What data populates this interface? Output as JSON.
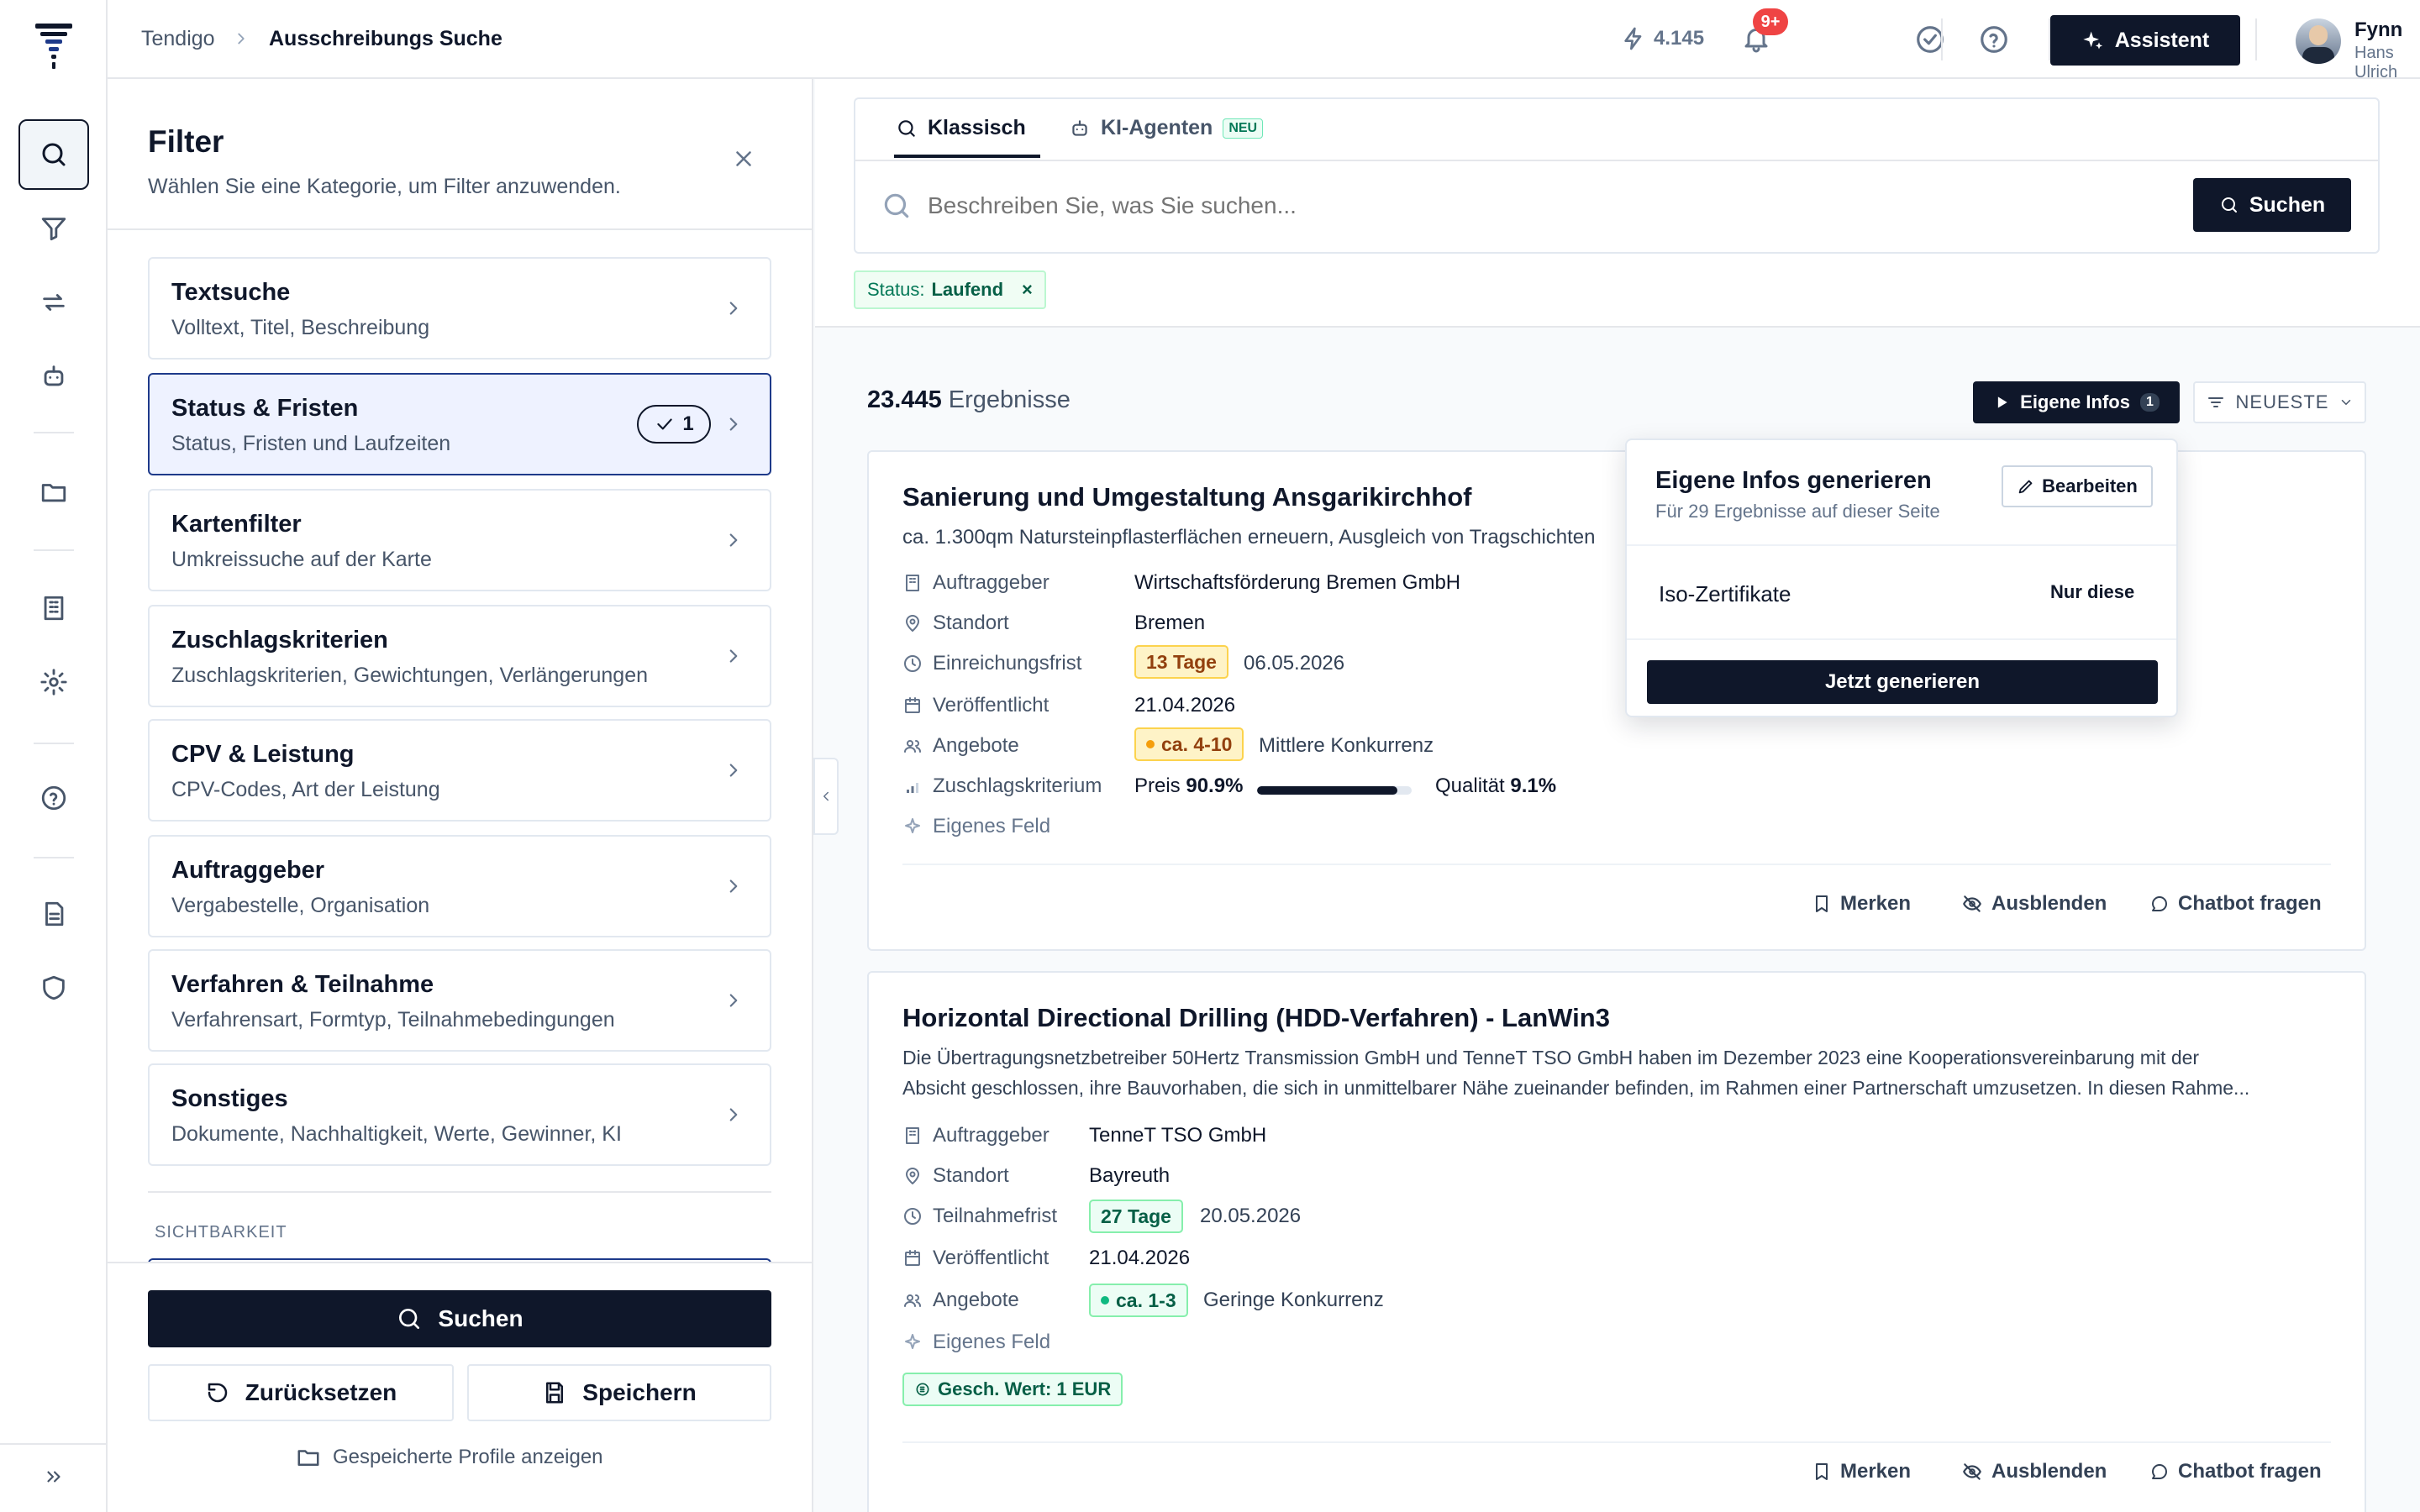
{
  "rail": {
    "items": [
      "search-icon",
      "filter-icon",
      "repeat-icon",
      "robot-icon",
      "folder-icon",
      "building-icon",
      "gear-icon",
      "help-icon",
      "document-icon",
      "shield-icon"
    ]
  },
  "header": {
    "breadcrumb_root": "Tendigo",
    "breadcrumb_current": "Ausschreibungs Suche",
    "credits": "4.145",
    "notif_badge": "9+",
    "assistant_label": "Assistent",
    "user_name": "Fynn",
    "user_sub": "Hans Ulrich"
  },
  "filter": {
    "title": "Filter",
    "subtitle": "Wählen Sie eine Kategorie, um Filter anzuwenden.",
    "categories": [
      {
        "title": "Textsuche",
        "sub": "Volltext, Titel, Beschreibung"
      },
      {
        "title": "Status & Fristen",
        "sub": "Status, Fristen und Laufzeiten",
        "count": "1"
      },
      {
        "title": "Kartenfilter",
        "sub": "Umkreissuche auf der Karte"
      },
      {
        "title": "Zuschlagskriterien",
        "sub": "Zuschlagskriterien, Gewichtungen, Verlängerungen"
      },
      {
        "title": "CPV & Leistung",
        "sub": "CPV-Codes, Art der Leistung"
      },
      {
        "title": "Auftraggeber",
        "sub": "Vergabestelle, Organisation"
      },
      {
        "title": "Verfahren & Teilnahme",
        "sub": "Verfahrensart, Formtyp, Teilnahmebedingungen"
      },
      {
        "title": "Sonstiges",
        "sub": "Dokumente, Nachhaltigkeit, Werte, Gewinner, KI"
      }
    ],
    "visibility_label": "SICHTBARKEIT",
    "search_btn": "Suchen",
    "reset_btn": "Zurücksetzen",
    "save_btn": "Speichern",
    "profiles_link": "Gespeicherte Profile anzeigen"
  },
  "search": {
    "tab_classic": "Klassisch",
    "tab_agents": "KI-Agenten",
    "tab_agents_badge": "NEU",
    "placeholder": "Beschreiben Sie, was Sie suchen...",
    "button": "Suchen",
    "chip_key": "Status:",
    "chip_value": "Laufend",
    "chip_close": "×"
  },
  "results": {
    "count": "23.445",
    "count_label": "Ergebnisse",
    "own_info_btn": "Eigene Infos",
    "own_info_count": "1",
    "sort_label": "NEUESTE"
  },
  "popover": {
    "title": "Eigene Infos generieren",
    "subtitle": "Für 29 Ergebnisse auf dieser Seite",
    "edit_btn": "Bearbeiten",
    "item_label": "Iso-Zertifikate",
    "item_action": "Nur diese",
    "generate_btn": "Jetzt generieren"
  },
  "cards": [
    {
      "title": "Sanierung und Umgestaltung Ansgarikirchhof",
      "desc": "ca. 1.300qm Natursteinpflasterflächen erneuern, Ausgleich von Tragschichten",
      "labels": {
        "client": "Auftraggeber",
        "location": "Standort",
        "deadline": "Einreichungsfrist",
        "published": "Veröffentlicht",
        "offers": "Angebote",
        "criteria": "Zuschlagskriterium",
        "custom": "Eigenes Feld"
      },
      "client": "Wirtschaftsförderung Bremen GmbH",
      "location": "Bremen",
      "deadline_badge": "13 Tage",
      "deadline_date": "06.05.2026",
      "published": "21.04.2026",
      "offers_badge": "ca. 4-10",
      "offers_text": "Mittlere Konkurrenz",
      "price_label": "Preis",
      "price_pct": "90.9%",
      "price_fraction": 0.909,
      "quality_label": "Qualität",
      "quality_pct": "9.1%",
      "actions": {
        "save": "Merken",
        "hide": "Ausblenden",
        "chat": "Chatbot fragen"
      }
    },
    {
      "title": "Horizontal Directional Drilling (HDD-Verfahren) - LanWin3",
      "desc1": "Die Übertragungsnetzbetreiber 50Hertz Transmission GmbH und TenneT TSO GmbH haben im Dezember 2023 eine Kooperationsvereinbarung mit der",
      "desc2": "Absicht geschlossen, ihre Bauvorhaben, die sich in unmittelbarer Nähe zueinander befinden, im Rahmen einer Partnerschaft umzusetzen. In diesen Rahme...",
      "labels": {
        "client": "Auftraggeber",
        "location": "Standort",
        "deadline": "Teilnahmefrist",
        "published": "Veröffentlicht",
        "offers": "Angebote",
        "custom": "Eigenes Feld"
      },
      "client": "TenneT TSO GmbH",
      "location": "Bayreuth",
      "deadline_badge": "27 Tage",
      "deadline_date": "20.05.2026",
      "published": "21.04.2026",
      "offers_badge": "ca. 1-3",
      "offers_text": "Geringe Konkurrenz",
      "value_badge": "Gesch. Wert: 1 EUR",
      "actions": {
        "save": "Merken",
        "hide": "Ausblenden",
        "chat": "Chatbot fragen"
      }
    }
  ],
  "colors": {
    "navy": "#0f172a",
    "accent_selected": "#1e3a8a",
    "amber_badge": "#fef3c7",
    "green_badge": "#ecfdf5",
    "red_badge": "#ef4444"
  }
}
